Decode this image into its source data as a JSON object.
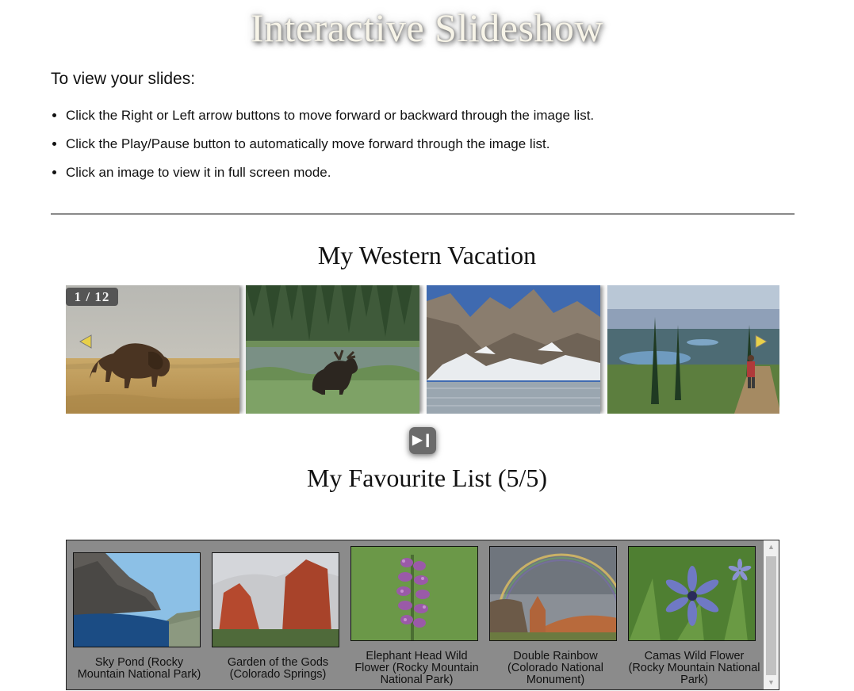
{
  "page": {
    "title": "Interactive Slideshow",
    "intro_heading": "To view your slides:",
    "instructions": [
      "Click the Right or Left arrow buttons to move forward or backward through the image list.",
      "Click the Play/Pause button to automatically move forward through the image list.",
      "Click an image to view it in full screen mode."
    ]
  },
  "slideshow": {
    "title": "My Western Vacation",
    "counter": "1 / 12",
    "prev_icon": "triangle-left-icon",
    "next_icon": "triangle-right-icon",
    "play_pause_icon": "play-pause-icon",
    "play_pause_glyph": "▶❙",
    "slides": [
      {
        "subject": "bison on prairie"
      },
      {
        "subject": "moose in meadow"
      },
      {
        "subject": "mountain lake with snow"
      },
      {
        "subject": "hiker on mountain trail"
      }
    ]
  },
  "favourites": {
    "title": "My Favourite List (5/5)",
    "items": [
      {
        "caption_line1": "Sky Pond (Rocky",
        "caption_line2": "Mountain National Park)",
        "caption_line3": ""
      },
      {
        "caption_line1": "Garden of the Gods",
        "caption_line2": "(Colorado Springs)",
        "caption_line3": ""
      },
      {
        "caption_line1": "Elephant Head Wild",
        "caption_line2": "Flower (Rocky Mountain",
        "caption_line3": "National Park)"
      },
      {
        "caption_line1": "Double Rainbow",
        "caption_line2": "(Colorado National",
        "caption_line3": "Monument)"
      },
      {
        "caption_line1": "Camas Wild Flower",
        "caption_line2": "(Rocky Mountain National",
        "caption_line3": "Park)"
      }
    ],
    "scroll_up_glyph": "▲",
    "scroll_down_glyph": "▼"
  },
  "colors": {
    "title_text": "#f7f4e8",
    "arrow_fill": "#e8d04a",
    "favourites_bg": "#8b8b8b"
  }
}
